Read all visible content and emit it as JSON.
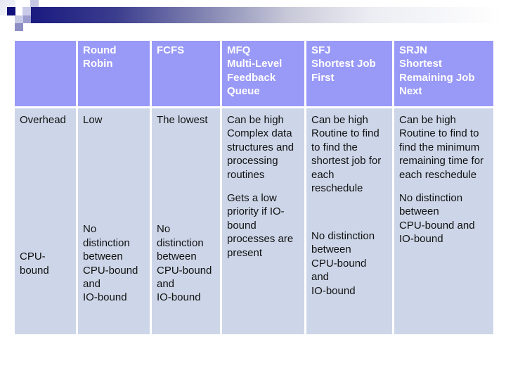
{
  "slide": {
    "banner_colors": {
      "dark": "#1a1a80",
      "light": "#ffffff"
    },
    "table_colors": {
      "header_bg": "#9999f7",
      "header_text": "#ffffff",
      "body_bg": "#cdd6e8",
      "body_text": "#111111"
    }
  },
  "table": {
    "headers": [
      "",
      "Round\nRobin",
      "FCFS",
      "MFQ\nMulti-Level\nFeedback\nQueue",
      "SFJ\nShortest Job\nFirst",
      "SRJN\nShortest\nRemaining Job\nNext"
    ],
    "rows": [
      {
        "label": "Overhead",
        "cells": [
          "Low",
          "The lowest",
          "Can be high\nComplex data\nstructures and\nprocessing\nroutines",
          "Can be high\nRoutine to find\nto find the\nshortest job for\neach\nreschedule",
          "Can be high\nRoutine to find to\nfind the minimum\nremaining time for\neach reschedule"
        ]
      },
      {
        "label": "CPU-\nbound",
        "cells": [
          "No\ndistinction\nbetween\nCPU-bound\nand\nIO-bound",
          "No\ndistinction\nbetween\nCPU-bound\nand\nIO-bound",
          "Gets a low\npriority if IO-\nbound\nprocesses are\npresent",
          "No distinction\nbetween\nCPU-bound\nand\nIO-bound",
          "No distinction\nbetween\nCPU-bound and\nIO-bound"
        ]
      }
    ]
  }
}
